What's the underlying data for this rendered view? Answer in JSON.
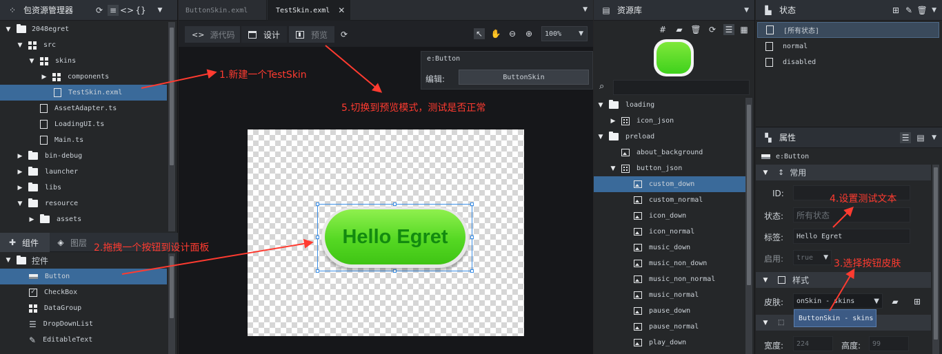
{
  "left_panel": {
    "title": "包资源管理器",
    "tree": [
      {
        "label": "2048egret"
      },
      {
        "label": "src"
      },
      {
        "label": "skins"
      },
      {
        "label": "components"
      },
      {
        "label": "TestSkin.exml"
      },
      {
        "label": "AssetAdapter.ts"
      },
      {
        "label": "LoadingUI.ts"
      },
      {
        "label": "Main.ts"
      },
      {
        "label": "bin-debug"
      },
      {
        "label": "launcher"
      },
      {
        "label": "libs"
      },
      {
        "label": "resource"
      },
      {
        "label": "assets"
      }
    ]
  },
  "components_panel": {
    "tab_components": "组件",
    "tab_layers": "图层",
    "group": "控件",
    "items": [
      {
        "label": "Button"
      },
      {
        "label": "CheckBox"
      },
      {
        "label": "DataGroup"
      },
      {
        "label": "DropDownList"
      },
      {
        "label": "EditableText"
      }
    ]
  },
  "editor": {
    "tabs": [
      {
        "label": "ButtonSkin.exml"
      },
      {
        "label": "TestSkin.exml"
      }
    ],
    "mode_source": "源代码",
    "mode_design": "设计",
    "mode_preview": "预览",
    "zoom": "100%",
    "host_component": "e:Button",
    "edit_label": "编辑:",
    "edit_value": "ButtonSkin",
    "button_text": "Hello Egret"
  },
  "resource_panel": {
    "title": "资源库",
    "tree": [
      {
        "label": "loading"
      },
      {
        "label": "icon_json"
      },
      {
        "label": "preload"
      },
      {
        "label": "about_background"
      },
      {
        "label": "button_json"
      },
      {
        "label": "custom_down"
      },
      {
        "label": "custom_normal"
      },
      {
        "label": "icon_down"
      },
      {
        "label": "icon_normal"
      },
      {
        "label": "music_down"
      },
      {
        "label": "music_non_down"
      },
      {
        "label": "music_non_normal"
      },
      {
        "label": "music_normal"
      },
      {
        "label": "pause_down"
      },
      {
        "label": "pause_normal"
      },
      {
        "label": "play_down"
      }
    ]
  },
  "state_panel": {
    "title": "状态",
    "states": [
      {
        "label": "[所有状态]"
      },
      {
        "label": "normal"
      },
      {
        "label": "disabled"
      }
    ]
  },
  "props_panel": {
    "title": "属性",
    "component": "e:Button",
    "section_common": "常用",
    "id_label": "ID:",
    "state_label": "状态:",
    "state_placeholder": "所有状态",
    "label_label": "标签:",
    "label_value": "Hello Egret",
    "enabled_label": "启用:",
    "enabled_value": "true",
    "section_style": "样式",
    "skin_label": "皮肤:",
    "skin_value": "onSkin - skins",
    "skin_option": "ButtonSkin - skins",
    "width_label": "宽度:",
    "width_value": "224",
    "height_label": "高度:",
    "height_value": "99"
  },
  "annotations": {
    "a1": "1.新建一个TestSkin",
    "a2": "2.拖拽一个按钮到设计面板",
    "a3": "3.选择按钮皮肤",
    "a4": "4.设置测试文本",
    "a5": "5.切换到预览模式，测试是否正常"
  },
  "colors": {
    "annotation": "#ff3b30",
    "button_green": "#4cd82a",
    "selection": "#3a6a9a"
  }
}
